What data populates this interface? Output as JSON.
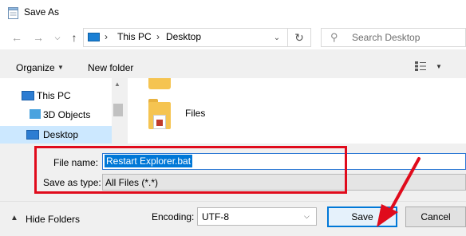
{
  "window": {
    "title": "Save As"
  },
  "nav": {
    "back_icon": "arrow-left-icon",
    "forward_icon": "arrow-right-icon",
    "recent_icon": "chevron-down-icon",
    "up_icon": "arrow-up-icon",
    "breadcrumbs": [
      "This PC",
      "Desktop"
    ],
    "refresh_icon": "refresh-icon",
    "search_placeholder": "Search Desktop"
  },
  "toolbar": {
    "organize_label": "Organize",
    "new_folder_label": "New folder",
    "view_icon": "view-options-icon"
  },
  "sidebar": {
    "items": [
      {
        "label": "This PC",
        "icon": "computer-icon"
      },
      {
        "label": "3D Objects",
        "icon": "cube-icon"
      },
      {
        "label": "Desktop",
        "icon": "desktop-icon",
        "selected": true
      }
    ]
  },
  "content": {
    "items": [
      {
        "label": "Files",
        "icon": "folder-icon"
      }
    ]
  },
  "form": {
    "file_name_label": "File name:",
    "file_name_value": "Restart Explorer.bat",
    "save_as_type_label": "Save as type:",
    "save_as_type_value": "All Files  (*.*)"
  },
  "footer": {
    "hide_folders_label": "Hide Folders",
    "encoding_label": "Encoding:",
    "encoding_value": "UTF-8",
    "save_label": "Save",
    "cancel_label": "Cancel"
  },
  "annotations": {
    "highlight_color": "#e00b1c"
  }
}
